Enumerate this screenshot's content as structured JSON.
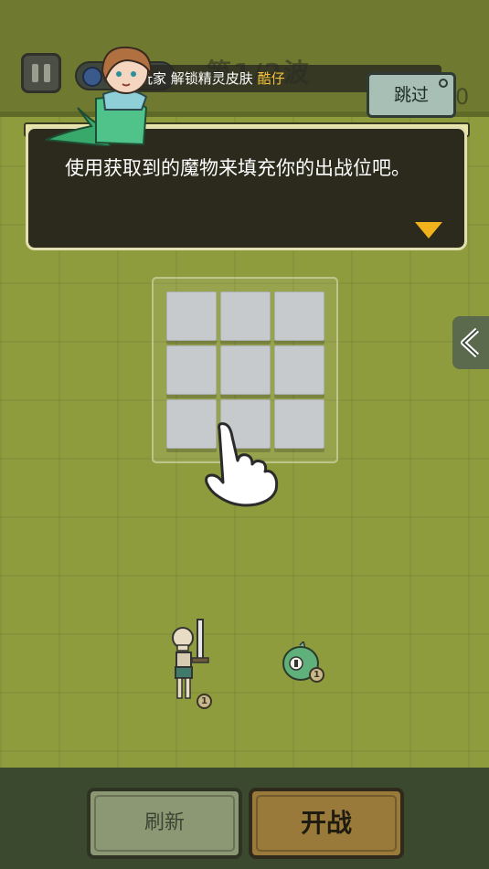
{
  "hud": {
    "wave_title": "第1/2波",
    "ticker_text": "玩家 解锁精灵皮肤",
    "ticker_highlight": "酷仔",
    "skip_label": "跳过",
    "stray_count": "0"
  },
  "dialog": {
    "text": "使用获取到的魔物来填充你的出战位吧。"
  },
  "board": {
    "slots": 9
  },
  "units": [
    {
      "name": "skeleton-warrior",
      "level": "1"
    },
    {
      "name": "green-slime",
      "level": "1"
    }
  ],
  "buttons": {
    "refresh_label": "刷新",
    "fight_label": "开战"
  },
  "colors": {
    "grass": "#8f9c3e",
    "dialog_bg": "#2b2a1c",
    "highlight": "#f4c23a",
    "fight_button": "#9a7a3a",
    "refresh_button": "#8c9874"
  }
}
